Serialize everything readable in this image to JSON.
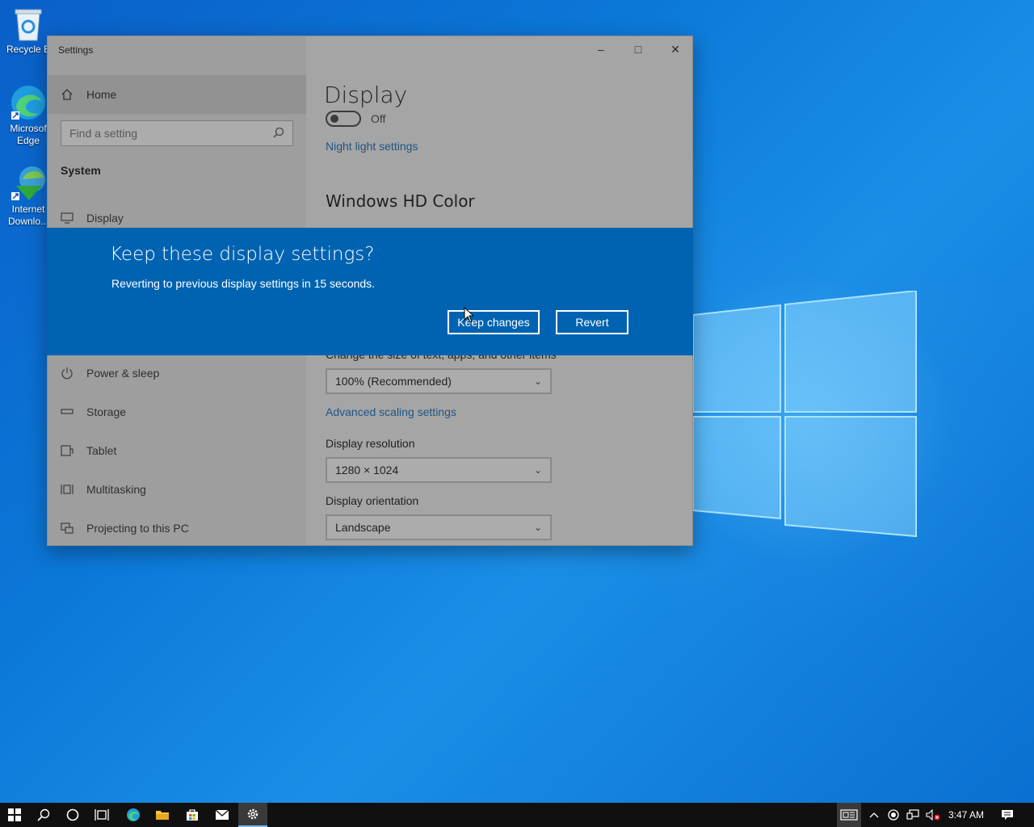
{
  "desktop": {
    "icons": [
      {
        "label": "Recycle B",
        "icon": "recycle-bin-icon"
      },
      {
        "label": "Microsof Edge",
        "icon": "edge-icon"
      },
      {
        "label": "Internet Downlo...",
        "icon": "idm-icon"
      }
    ]
  },
  "window": {
    "title": "Settings",
    "controls": {
      "minimize": "–",
      "maximize": "□",
      "close": "✕"
    }
  },
  "sidebar": {
    "home_label": "Home",
    "search_placeholder": "Find a setting",
    "section": "System",
    "items": [
      {
        "label": "Display",
        "icon": "monitor-icon"
      },
      {
        "label": "Power & sleep",
        "icon": "power-icon"
      },
      {
        "label": "Storage",
        "icon": "storage-icon"
      },
      {
        "label": "Tablet",
        "icon": "tablet-icon"
      },
      {
        "label": "Multitasking",
        "icon": "multitasking-icon"
      },
      {
        "label": "Projecting to this PC",
        "icon": "projecting-icon"
      }
    ]
  },
  "content": {
    "title": "Display",
    "night_light_toggle": "Off",
    "night_light_link": "Night light settings",
    "hd_color_heading": "Windows HD Color",
    "scale_label": "Change the size of text, apps, and other items",
    "scale_value": "100% (Recommended)",
    "advanced_scaling_link": "Advanced scaling settings",
    "resolution_label": "Display resolution",
    "resolution_value": "1280 × 1024",
    "orientation_label": "Display orientation",
    "orientation_value": "Landscape"
  },
  "dialog": {
    "title": "Keep these display settings?",
    "message": "Reverting to previous display settings in 15 seconds.",
    "keep_button": "Keep changes",
    "revert_button": "Revert"
  },
  "taskbar": {
    "clock": "3:47 AM",
    "apps": [
      "start-icon",
      "search-icon",
      "cortana-icon",
      "task-view-icon",
      "edge-icon",
      "file-explorer-icon",
      "store-icon",
      "mail-icon",
      "settings-icon"
    ],
    "active_app": "settings-icon"
  },
  "colors": {
    "accent": "#0063b1",
    "desktop": "#0b78d8",
    "taskbar": "#101010"
  }
}
